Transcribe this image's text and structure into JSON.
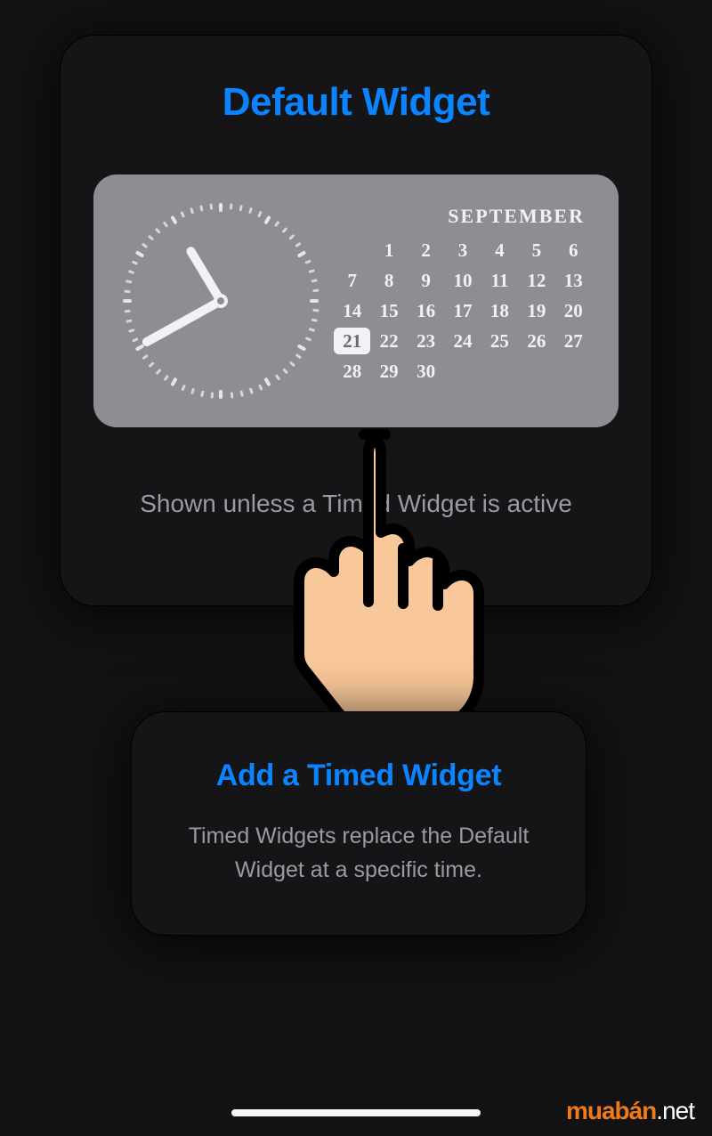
{
  "defaultWidget": {
    "title": "Default Widget",
    "caption": "Shown unless a Timed Widget is active"
  },
  "calendar": {
    "month": "SEPTEMBER",
    "first_weekday_index": 1,
    "days_in_month": 30,
    "selected": 21
  },
  "clock": {
    "hour_angle_deg": -31,
    "minute_angle_deg": -119
  },
  "addWidget": {
    "title": "Add a Timed Widget",
    "description": "Timed Widgets replace the Default Widget at a specific time."
  },
  "watermark": {
    "brand": "muabán",
    "tld": ".net"
  }
}
